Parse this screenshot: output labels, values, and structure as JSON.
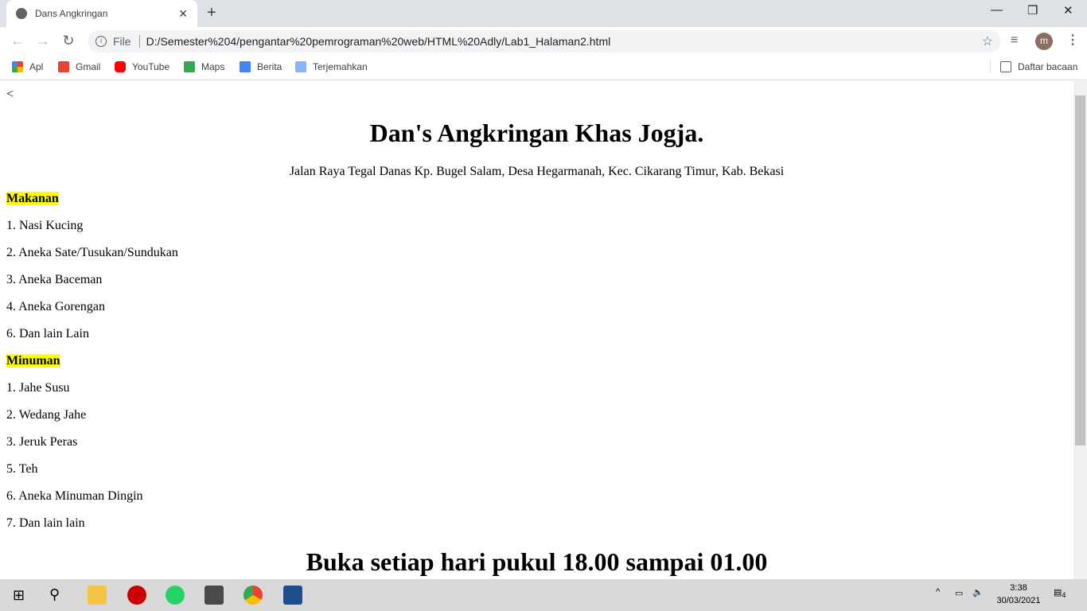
{
  "browser": {
    "tab_title": "Dans Angkringan",
    "file_label": "File",
    "url": "D:/Semester%204/pengantar%20pemrograman%20web/HTML%20Adly/Lab1_Halaman2.html",
    "avatar_letter": "m",
    "bookmarks": [
      "Apl",
      "Gmail",
      "YouTube",
      "Maps",
      "Berita",
      "Terjemahkan"
    ],
    "reading_list": "Daftar bacaan"
  },
  "page": {
    "back_link": "<",
    "title": "Dan's Angkringan Khas Jogja.",
    "address": "Jalan Raya Tegal Danas Kp. Bugel Salam, Desa Hegarmanah, Kec. Cikarang Timur, Kab. Bekasi",
    "food_heading": "Makanan",
    "food": [
      "1. Nasi Kucing",
      "2. Aneka Sate/Tusukan/Sundukan",
      "3. Aneka Baceman",
      "4. Aneka Gorengan",
      "6. Dan lain Lain"
    ],
    "drink_heading": "Minuman",
    "drinks": [
      "1. Jahe Susu",
      "2. Wedang Jahe",
      "3. Jeruk Peras",
      "5. Teh",
      "6. Aneka Minuman Dingin",
      "7. Dan lain lain"
    ],
    "hours": "Buka setiap hari pukul 18.00 sampai 01.00"
  },
  "taskbar": {
    "time": "3:38",
    "date": "30/03/2021",
    "notifications": "4"
  },
  "colors": {
    "highlight": "#ffff00",
    "avatar": "#8d6e63"
  }
}
